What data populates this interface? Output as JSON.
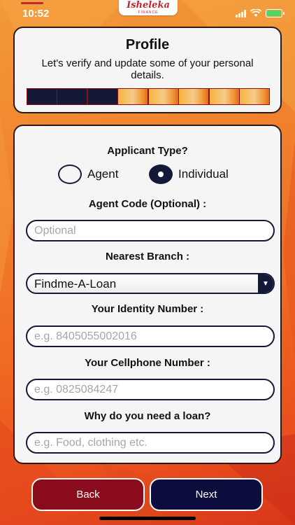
{
  "status_bar": {
    "time": "10:52"
  },
  "logo": {
    "name": "Isheleka",
    "tagline": "FINANCE"
  },
  "header": {
    "title": "Profile",
    "subtitle": "Let's verify and update some of your personal details.",
    "progress": {
      "completed_steps": 3,
      "total_steps": 8
    }
  },
  "form": {
    "applicant_type_label": "Applicant Type?",
    "applicant_options": [
      {
        "label": "Agent",
        "selected": false
      },
      {
        "label": "Individual",
        "selected": true
      }
    ],
    "agent_code_label": "Agent Code (Optional) :",
    "agent_code_placeholder": "Optional",
    "branch_label": "Nearest Branch :",
    "branch_value": "Findme-A-Loan",
    "identity_label": "Your Identity Number :",
    "identity_placeholder": "e.g. 8405055002016",
    "cellphone_label": "Your Cellphone Number :",
    "cellphone_placeholder": "e.g. 0825084247",
    "reason_label": "Why do you need a loan?",
    "reason_placeholder": "e.g. Food, clothing etc."
  },
  "buttons": {
    "back": "Back",
    "next": "Next"
  },
  "colors": {
    "navy": "#151938",
    "maroon": "#8a0c1c",
    "orange": "#f07f2c"
  }
}
